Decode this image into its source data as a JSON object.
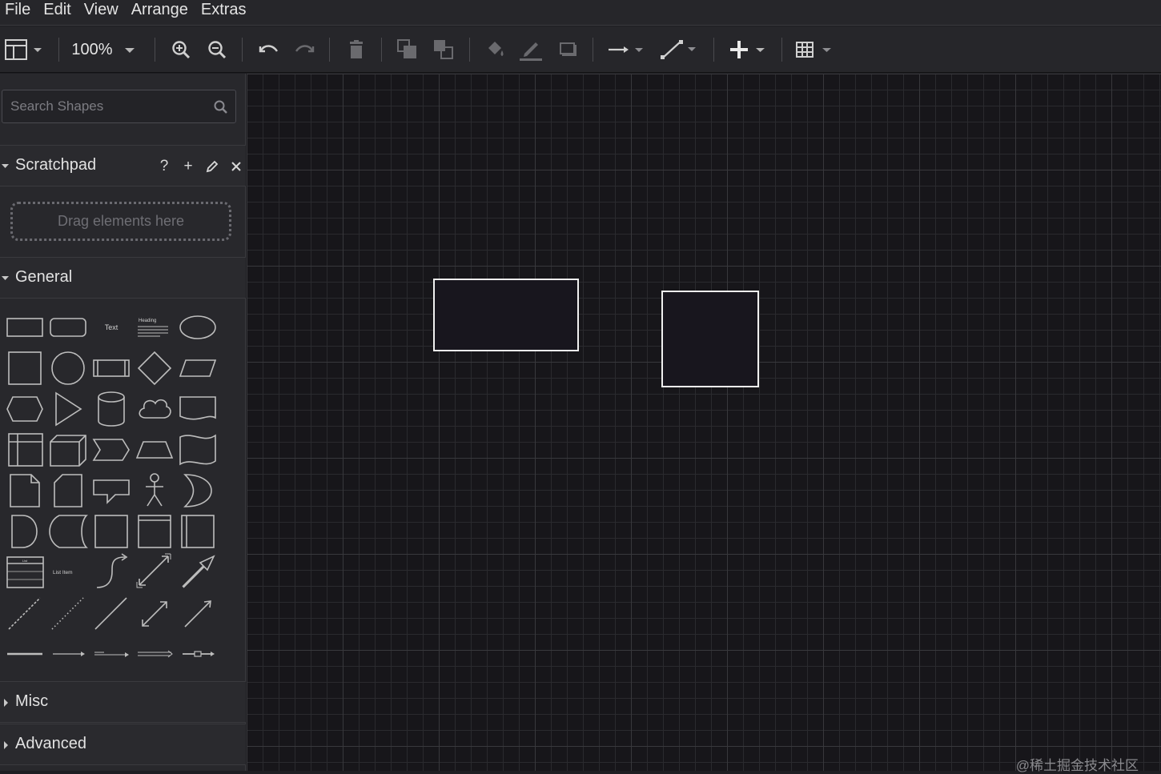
{
  "menu": [
    "File",
    "Edit",
    "View",
    "Arrange",
    "Extras"
  ],
  "toolbar": {
    "zoom_label": "100%",
    "icons": [
      "format-panel-icon",
      "zoom-in-icon",
      "zoom-out-icon",
      "undo-icon",
      "redo-icon",
      "delete-icon",
      "to-front-icon",
      "to-back-icon",
      "fill-color-icon",
      "line-color-icon",
      "shadow-icon",
      "connection-icon",
      "waypoints-icon",
      "insert-icon",
      "table-icon"
    ]
  },
  "sidebar": {
    "search_placeholder": "Search Shapes",
    "scratchpad": {
      "title": "Scratchpad",
      "help": "?",
      "add": "+",
      "drop_hint": "Drag elements here"
    },
    "general": {
      "title": "General",
      "text_shape": "Text",
      "heading_shape": "Heading",
      "list_item_shape": "List Item",
      "list_shape": "List"
    },
    "misc": {
      "title": "Misc"
    },
    "advanced": {
      "title": "Advanced"
    }
  },
  "colors": {
    "background": "#17161a",
    "panel": "#28282c",
    "shape_stroke": "#f0f0f0"
  },
  "watermark": "@稀土掘金技术社区"
}
